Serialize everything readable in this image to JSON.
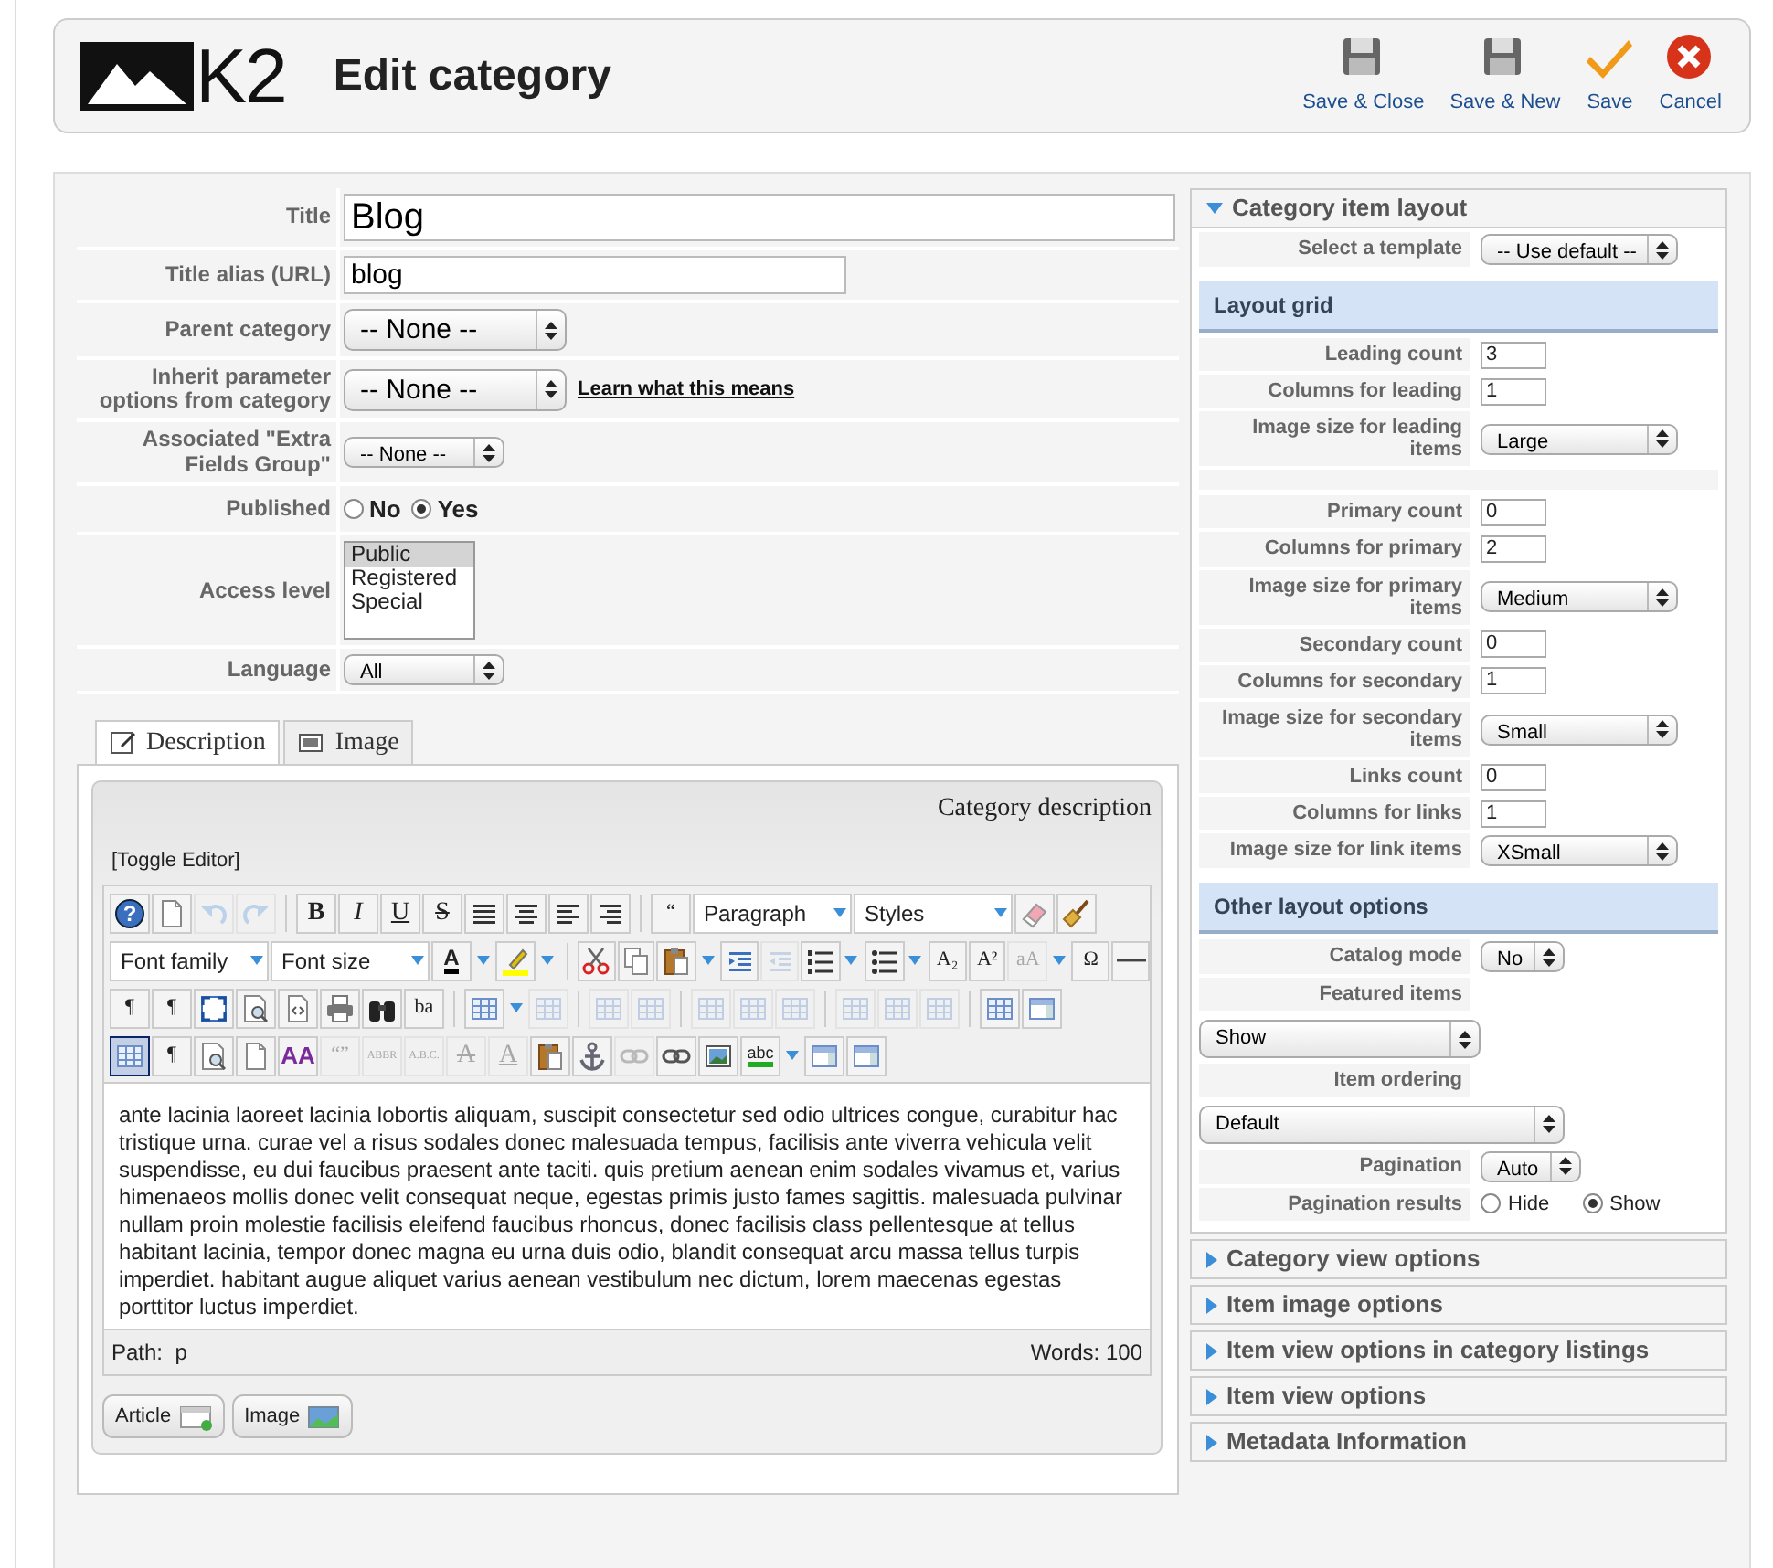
{
  "header": {
    "logo": "K2",
    "title": "Edit category",
    "actions": [
      {
        "kind": "save",
        "label": "Save & Close"
      },
      {
        "kind": "save",
        "label": "Save & New"
      },
      {
        "kind": "check",
        "label": "Save"
      },
      {
        "kind": "cancel",
        "label": "Cancel"
      }
    ]
  },
  "form": [
    {
      "kind": "title",
      "label": "Title",
      "value": "Blog"
    },
    {
      "kind": "text",
      "label": "Title alias (URL)",
      "value": "blog"
    },
    {
      "kind": "select-large",
      "label": "Parent category",
      "value": "-- None --"
    },
    {
      "kind": "select-large",
      "label": "Inherit parameter options from category",
      "value": "-- None --",
      "link": "Learn what this means"
    },
    {
      "kind": "select",
      "label": "Associated \"Extra Fields Group\"",
      "value": "-- None --"
    },
    {
      "kind": "radio",
      "label": "Published",
      "options": [
        {
          "label": "No",
          "selected": false
        },
        {
          "label": "Yes",
          "selected": true
        }
      ]
    },
    {
      "kind": "listbox",
      "label": "Access level",
      "options": [
        {
          "label": "Public",
          "selected": true
        },
        {
          "label": "Registered",
          "selected": false
        },
        {
          "label": "Special",
          "selected": false
        }
      ]
    },
    {
      "kind": "select",
      "label": "Language",
      "value": "All"
    }
  ],
  "tabs": [
    {
      "kind": "edit",
      "label": "Description",
      "selected": true
    },
    {
      "kind": "image",
      "label": "Image",
      "selected": false
    }
  ],
  "editor": {
    "caption": "Category description",
    "toggle": "[Toggle Editor]",
    "toolbar": [
      [
        {
          "kind": "help",
          "glyph": "?"
        },
        {
          "kind": "page"
        },
        {
          "kind": "undo",
          "disabled": true
        },
        {
          "kind": "redo",
          "disabled": true
        },
        {
          "kind": "sep"
        },
        {
          "kind": "bold",
          "glyph": "B"
        },
        {
          "kind": "italic",
          "glyph": "I"
        },
        {
          "kind": "underline",
          "glyph": "U"
        },
        {
          "kind": "strike",
          "glyph": "S"
        },
        {
          "kind": "align-justify"
        },
        {
          "kind": "align-center"
        },
        {
          "kind": "align-left"
        },
        {
          "kind": "align-right"
        },
        {
          "kind": "sep"
        },
        {
          "kind": "glyph",
          "glyph": "“"
        },
        {
          "kind": "dropdown",
          "value": "Paragraph"
        },
        {
          "kind": "dropdown",
          "value": "Styles"
        },
        {
          "kind": "eraser"
        },
        {
          "kind": "broom"
        }
      ],
      [
        {
          "kind": "dropdown",
          "value": "Font family"
        },
        {
          "kind": "dropdown",
          "value": "Font size"
        },
        {
          "kind": "color",
          "glyph": "A",
          "split": true
        },
        {
          "kind": "highlight",
          "split": true
        },
        {
          "kind": "sep"
        },
        {
          "kind": "scissors"
        },
        {
          "kind": "copy"
        },
        {
          "kind": "paste",
          "split": true
        },
        {
          "kind": "indent"
        },
        {
          "kind": "outdent",
          "disabled": true
        },
        {
          "kind": "numlist",
          "split": true
        },
        {
          "kind": "bullist",
          "split": true
        },
        {
          "kind": "glyph",
          "glyph": "A₂"
        },
        {
          "kind": "glyph",
          "glyph": "A²"
        },
        {
          "kind": "glyph",
          "glyph": "aA",
          "disabled": true,
          "split": true
        },
        {
          "kind": "glyph",
          "glyph": "Ω"
        },
        {
          "kind": "hr"
        }
      ],
      [
        {
          "kind": "glyph",
          "glyph": "¶"
        },
        {
          "kind": "glyph",
          "glyph": "¶"
        },
        {
          "kind": "fullscreen"
        },
        {
          "kind": "preview"
        },
        {
          "kind": "code"
        },
        {
          "kind": "print"
        },
        {
          "kind": "binoculars"
        },
        {
          "kind": "glyph",
          "glyph": "ba"
        },
        {
          "kind": "sep"
        },
        {
          "kind": "table",
          "split": true
        },
        {
          "kind": "table",
          "disabled": true
        },
        {
          "kind": "sep"
        },
        {
          "kind": "table",
          "disabled": true
        },
        {
          "kind": "table",
          "disabled": true
        },
        {
          "kind": "sep"
        },
        {
          "kind": "table",
          "disabled": true
        },
        {
          "kind": "table",
          "disabled": true
        },
        {
          "kind": "table",
          "disabled": true
        },
        {
          "kind": "sep"
        },
        {
          "kind": "table",
          "disabled": true
        },
        {
          "kind": "table",
          "disabled": true
        },
        {
          "kind": "table",
          "disabled": true
        },
        {
          "kind": "sep"
        },
        {
          "kind": "table"
        },
        {
          "kind": "layout"
        }
      ],
      [
        {
          "kind": "table",
          "active": true
        },
        {
          "kind": "glyph",
          "glyph": "¶"
        },
        {
          "kind": "preview"
        },
        {
          "kind": "page"
        },
        {
          "kind": "styled",
          "glyph": "AA"
        },
        {
          "kind": "glyph",
          "glyph": "“”",
          "disabled": true
        },
        {
          "kind": "glyph",
          "glyph": "ABBR",
          "disabled": true
        },
        {
          "kind": "glyph",
          "glyph": "A.B.C.",
          "disabled": true
        },
        {
          "kind": "strike",
          "glyph": "A",
          "disabled": true
        },
        {
          "kind": "underline",
          "glyph": "A",
          "disabled": true
        },
        {
          "kind": "paste"
        },
        {
          "kind": "anchor"
        },
        {
          "kind": "link",
          "disabled": true
        },
        {
          "kind": "link"
        },
        {
          "kind": "image"
        },
        {
          "kind": "spell",
          "glyph": "abc",
          "split": true
        },
        {
          "kind": "layout"
        },
        {
          "kind": "layout"
        }
      ]
    ],
    "content": "ante lacinia laoreet lacinia lobortis aliquam, suscipit consectetur sed odio ultrices congue, curabitur hac tristique urna. curae vel a risus sodales donec malesuada tempus, facilisis ante viverra vehicula velit suspendisse, eu dui faucibus praesent ante taciti. quis pretium aenean enim sodales vivamus et, varius himenaeos mollis donec velit consequat neque, egestas primis justo fames sagittis. malesuada pulvinar nullam proin molestie facilisis eleifend faucibus rhoncus, donec facilisis class pellentesque at tellus habitant lacinia, tempor donec magna eu urna duis odio, blandit consequat arcu massa tellus turpis imperdiet. habitant augue aliquet varius aenean vestibulum nec dictum, lorem maecenas egestas porttitor luctus imperdiet.",
    "path_label": "Path:",
    "path": "p",
    "word_count": "Words: 100",
    "buttons": [
      {
        "kind": "article",
        "label": "Article"
      },
      {
        "kind": "image",
        "label": "Image"
      }
    ]
  },
  "panels": [
    {
      "title": "Category item layout",
      "expanded": true,
      "rows": [
        {
          "kind": "select",
          "label": "Select a template",
          "value": "-- Use default --"
        },
        {
          "kind": "heading",
          "label": "Layout grid"
        },
        {
          "kind": "number",
          "label": "Leading count",
          "value": "3"
        },
        {
          "kind": "number",
          "label": "Columns for leading",
          "value": "1"
        },
        {
          "kind": "size-select",
          "label": "Image size for leading items",
          "value": "Large"
        },
        {
          "kind": "spacer"
        },
        {
          "kind": "number",
          "label": "Primary count",
          "value": "0"
        },
        {
          "kind": "number",
          "label": "Columns for primary",
          "value": "2"
        },
        {
          "kind": "size-select",
          "label": "Image size for primary items",
          "value": "Medium"
        },
        {
          "kind": "number",
          "label": "Secondary count",
          "value": "0"
        },
        {
          "kind": "number",
          "label": "Columns for secondary",
          "value": "1"
        },
        {
          "kind": "size-select",
          "label": "Image size for secondary items",
          "value": "Small"
        },
        {
          "kind": "number",
          "label": "Links count",
          "value": "0"
        },
        {
          "kind": "number",
          "label": "Columns for links",
          "value": "1"
        },
        {
          "kind": "size-select",
          "label": "Image size for link items",
          "value": "XSmall"
        },
        {
          "kind": "heading",
          "label": "Other layout options"
        },
        {
          "kind": "select",
          "label": "Catalog mode",
          "value": "No"
        },
        {
          "kind": "stacked-select",
          "label": "Featured items",
          "value": "Show"
        },
        {
          "kind": "stacked-select-wide",
          "label": "Item ordering",
          "value": "Default"
        },
        {
          "kind": "select",
          "label": "Pagination",
          "value": "Auto"
        },
        {
          "kind": "radio",
          "label": "Pagination results",
          "options": [
            {
              "label": "Hide",
              "selected": false
            },
            {
              "label": "Show",
              "selected": true
            }
          ]
        }
      ]
    },
    {
      "title": "Category view options",
      "expanded": false
    },
    {
      "title": "Item image options",
      "expanded": false
    },
    {
      "title": "Item view options in category listings",
      "expanded": false
    },
    {
      "title": "Item view options",
      "expanded": false
    },
    {
      "title": "Metadata Information",
      "expanded": false
    }
  ]
}
